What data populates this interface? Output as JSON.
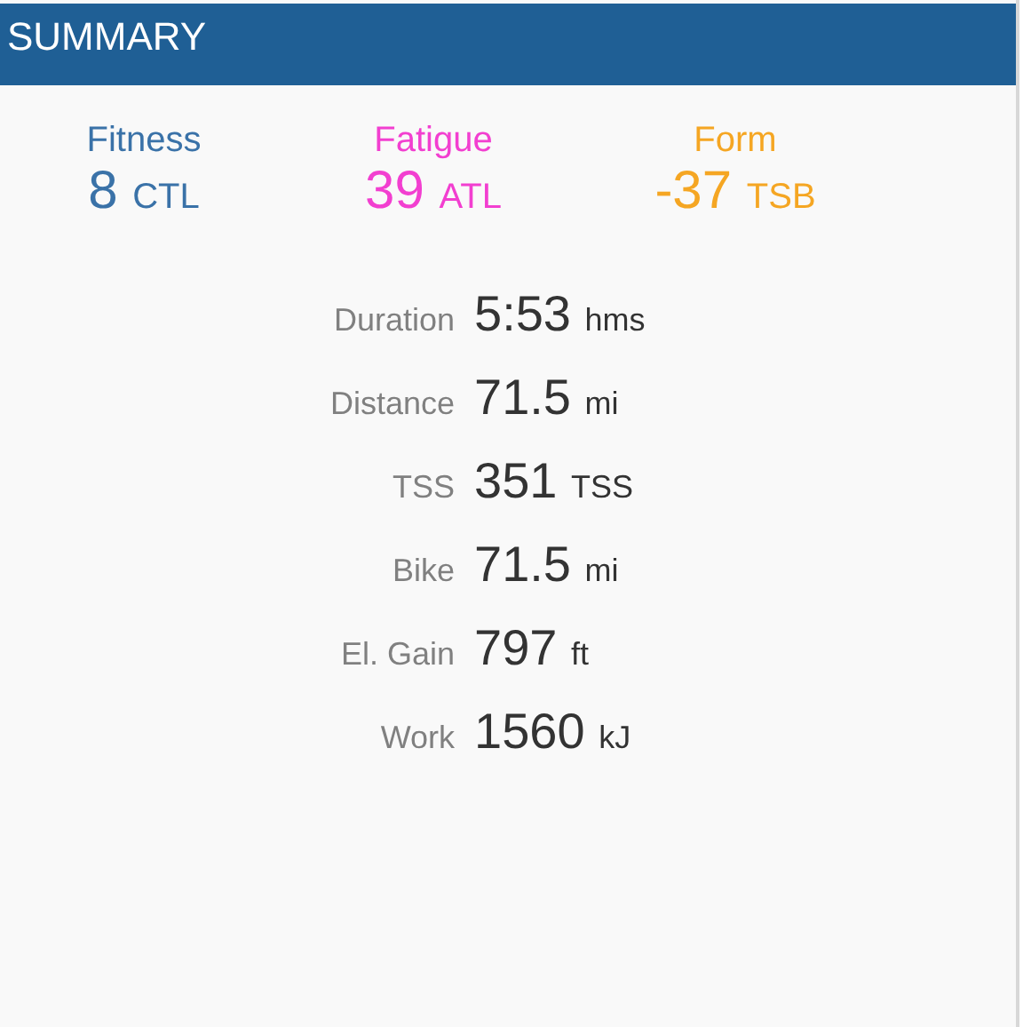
{
  "header": {
    "title": "SUMMARY"
  },
  "metrics": [
    {
      "label": "Fitness",
      "value": "8",
      "unit": "CTL",
      "color": "#3a72a8"
    },
    {
      "label": "Fatigue",
      "value": "39",
      "unit": "ATL",
      "color": "#f23fd0"
    },
    {
      "label": "Form",
      "value": "-37",
      "unit": "TSB",
      "color": "#f5a623"
    }
  ],
  "stats": [
    {
      "label": "Duration",
      "value": "5:53",
      "unit": "hms"
    },
    {
      "label": "Distance",
      "value": "71.5",
      "unit": "mi"
    },
    {
      "label": "TSS",
      "value": "351",
      "unit": "TSS"
    },
    {
      "label": "Bike",
      "value": "71.5",
      "unit": "mi"
    },
    {
      "label": "El. Gain",
      "value": "797",
      "unit": "ft"
    },
    {
      "label": "Work",
      "value": "1560",
      "unit": "kJ"
    }
  ]
}
